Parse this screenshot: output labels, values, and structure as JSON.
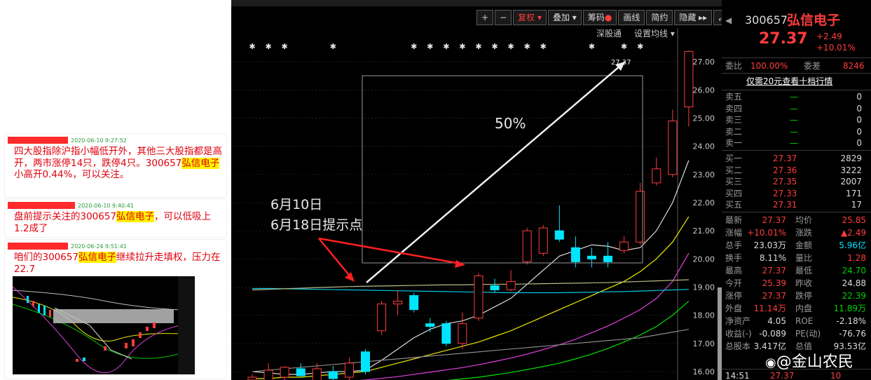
{
  "messages": [
    {
      "time": "2020-06-10 9:27:52",
      "parts": [
        "四大股指除沪指小幅低开外，其他三大股指都是高开，两市涨停14只，跌停4只。300657",
        "弘信电子",
        "小高开0.44%，可以关注。"
      ]
    },
    {
      "time": "2020-06-10 9:40:41",
      "parts": [
        "盘前提示关注的300657",
        "弘信电子",
        "，可以低吸上1.2成了"
      ]
    },
    {
      "time": "2020-06-24 9:51:41",
      "parts": [
        "咱们的300657",
        "弘信电子",
        "继续拉升走填权，压力在22.7"
      ]
    }
  ],
  "toolbar": {
    "fuquan": "复权 ▾",
    "diejia": "叠加 ▾",
    "chouma": "筹码",
    "huaxian": "画线",
    "jianyue": "简约",
    "yincang": "隐藏 ▸▸",
    "plus": "+",
    "minus": "−",
    "expand": "⤢"
  },
  "chart_header": {
    "shengutong": "深股通",
    "settings": "设置均线 ▾"
  },
  "annotations": {
    "pct": "50%",
    "d1": "6月10日",
    "d2": "6月18日提示点",
    "last": "27.37"
  },
  "chart_data": {
    "type": "candlestick",
    "y_axis_ticks": [
      "27.00",
      "26.00",
      "25.00",
      "24.00",
      "23.00",
      "22.00",
      "21.00",
      "20.00",
      "19.00",
      "18.00",
      "17.00",
      "16.00"
    ],
    "ylim": [
      15.7,
      28.2
    ],
    "candles": [
      {
        "o": 15.7,
        "c": 15.8,
        "h": 15.9,
        "l": 15.6
      },
      {
        "o": 15.65,
        "c": 16.05,
        "h": 16.3,
        "l": 15.5
      },
      {
        "o": 15.8,
        "c": 16.15,
        "h": 16.2,
        "l": 15.6
      },
      {
        "o": 16.1,
        "c": 15.85,
        "h": 16.3,
        "l": 15.8
      },
      {
        "o": 15.6,
        "c": 16.1,
        "h": 16.3,
        "l": 15.5
      },
      {
        "o": 16.0,
        "c": 15.75,
        "h": 16.2,
        "l": 15.6
      },
      {
        "o": 15.8,
        "c": 16.3,
        "h": 16.5,
        "l": 15.7
      },
      {
        "o": 16.7,
        "c": 16.0,
        "h": 16.8,
        "l": 15.9
      },
      {
        "o": 17.45,
        "c": 18.4,
        "h": 18.5,
        "l": 17.3
      },
      {
        "o": 18.4,
        "c": 18.5,
        "h": 18.9,
        "l": 18.0
      },
      {
        "o": 18.7,
        "c": 18.2,
        "h": 18.8,
        "l": 18.1
      },
      {
        "o": 17.7,
        "c": 17.6,
        "h": 17.9,
        "l": 17.4
      },
      {
        "o": 17.7,
        "c": 17.0,
        "h": 17.8,
        "l": 16.9
      },
      {
        "o": 17.0,
        "c": 17.7,
        "h": 18.1,
        "l": 16.8
      },
      {
        "o": 17.9,
        "c": 19.4,
        "h": 19.5,
        "l": 17.8
      },
      {
        "o": 19.05,
        "c": 18.9,
        "h": 19.3,
        "l": 18.8
      },
      {
        "o": 18.9,
        "c": 19.2,
        "h": 19.6,
        "l": 18.85
      },
      {
        "o": 19.9,
        "c": 21.0,
        "h": 21.1,
        "l": 19.8
      },
      {
        "o": 20.2,
        "c": 21.1,
        "h": 21.2,
        "l": 20.1
      },
      {
        "o": 21.0,
        "c": 20.7,
        "h": 21.9,
        "l": 20.6
      },
      {
        "o": 20.4,
        "c": 19.9,
        "h": 20.8,
        "l": 19.7
      },
      {
        "o": 20.1,
        "c": 20.0,
        "h": 20.4,
        "l": 19.7
      },
      {
        "o": 20.1,
        "c": 19.9,
        "h": 20.6,
        "l": 19.7
      },
      {
        "o": 20.3,
        "c": 20.6,
        "h": 20.8,
        "l": 20.2
      },
      {
        "o": 20.6,
        "c": 22.4,
        "h": 22.7,
        "l": 20.5
      },
      {
        "o": 22.7,
        "c": 23.2,
        "h": 23.6,
        "l": 22.6
      },
      {
        "o": 23.0,
        "c": 24.9,
        "h": 25.3,
        "l": 22.9
      },
      {
        "o": 25.4,
        "c": 27.37,
        "h": 27.4,
        "l": 24.7
      }
    ],
    "ma_series": [
      {
        "color": "#dcdcdc",
        "values": [
          16.0,
          15.95,
          15.9,
          15.9,
          15.95,
          16.0,
          16.0,
          16.05,
          16.4,
          16.8,
          17.2,
          17.5,
          17.7,
          17.8,
          18.0,
          18.3,
          18.6,
          19.1,
          19.6,
          20.1,
          20.3,
          20.5,
          20.45,
          20.3,
          20.4,
          21.0,
          22.0,
          23.5
        ]
      },
      {
        "color": "#e8e800",
        "values": [
          15.75,
          15.75,
          15.8,
          15.8,
          15.85,
          15.9,
          15.95,
          16.0,
          16.15,
          16.3,
          16.45,
          16.6,
          16.75,
          16.9,
          17.05,
          17.25,
          17.45,
          17.7,
          17.95,
          18.2,
          18.45,
          18.7,
          18.95,
          19.2,
          19.55,
          20.0,
          20.6,
          21.5
        ]
      },
      {
        "color": "#e040e0",
        "values": [
          15.5,
          15.5,
          15.52,
          15.55,
          15.58,
          15.62,
          15.66,
          15.7,
          15.76,
          15.82,
          15.9,
          15.98,
          16.06,
          16.14,
          16.24,
          16.36,
          16.48,
          16.62,
          16.78,
          16.95,
          17.15,
          17.38,
          17.62,
          17.9,
          18.2,
          18.6,
          19.2,
          20.2
        ]
      },
      {
        "color": "#00e000",
        "values": [
          15.3,
          15.32,
          15.34,
          15.36,
          15.38,
          15.4,
          15.43,
          15.46,
          15.5,
          15.54,
          15.58,
          15.63,
          15.68,
          15.74,
          15.8,
          15.88,
          15.97,
          16.07,
          16.18,
          16.3,
          16.45,
          16.62,
          16.82,
          17.05,
          17.3,
          17.6,
          18.0,
          18.5
        ]
      },
      {
        "color": "#00c8e6",
        "values": [
          18.95,
          18.95,
          18.94,
          18.93,
          18.92,
          18.91,
          18.9,
          18.89,
          18.88,
          18.87,
          18.86,
          18.85,
          18.84,
          18.83,
          18.82,
          18.81,
          18.8,
          18.8,
          18.8,
          18.8,
          18.81,
          18.82,
          18.83,
          18.84,
          18.86,
          18.88,
          18.9,
          18.92
        ]
      },
      {
        "color": "#bbbb88",
        "values": [
          18.9,
          18.92,
          18.94,
          18.96,
          18.98,
          19.0,
          19.02,
          19.03,
          19.04,
          19.05,
          19.06,
          19.07,
          19.08,
          19.08,
          19.09,
          19.1,
          19.1,
          19.11,
          19.12,
          19.13,
          19.14,
          19.15,
          19.16,
          19.18,
          19.2,
          19.22,
          19.24,
          19.26
        ]
      },
      {
        "color": "#8a8a8a",
        "values": [
          16.0,
          16.05,
          16.1,
          16.15,
          16.2,
          16.25,
          16.3,
          16.35,
          16.4,
          16.45,
          16.5,
          16.55,
          16.6,
          16.65,
          16.7,
          16.75,
          16.8,
          16.85,
          16.9,
          16.95,
          17.0,
          17.05,
          17.1,
          17.15,
          17.2,
          17.3,
          17.4,
          17.5
        ]
      }
    ],
    "star_markers": [
      0,
      1,
      2,
      5,
      10,
      11,
      12,
      13,
      14,
      15,
      16,
      17,
      18,
      21,
      23,
      24
    ]
  },
  "stock": {
    "code": "300657",
    "name": "弘信电子",
    "price": "27.37",
    "change": "+2.49",
    "pct": "+10.01%",
    "weibi_label": "委比",
    "weibi": "100.00%",
    "weicha_label": "委差",
    "weicha": "8246",
    "promo": "仅需20元查看十档行情",
    "sells": [
      {
        "label": "卖五",
        "price": "—",
        "vol": "0"
      },
      {
        "label": "卖四",
        "price": "—",
        "vol": "0"
      },
      {
        "label": "卖三",
        "price": "—",
        "vol": "0"
      },
      {
        "label": "卖二",
        "price": "—",
        "vol": "0"
      },
      {
        "label": "卖一",
        "price": "—",
        "vol": "0"
      }
    ],
    "buys": [
      {
        "label": "买一",
        "price": "27.37",
        "vol": "2829"
      },
      {
        "label": "买二",
        "price": "27.36",
        "vol": "3222"
      },
      {
        "label": "买三",
        "price": "27.35",
        "vol": "2007"
      },
      {
        "label": "买四",
        "price": "27.33",
        "vol": "171"
      },
      {
        "label": "买五",
        "price": "27.31",
        "vol": "17"
      }
    ],
    "stats": [
      {
        "l1": "最新",
        "v1": "27.37",
        "c1": "r",
        "l2": "均价",
        "v2": "25.85",
        "c2": "r"
      },
      {
        "l1": "涨幅",
        "v1": "+10.01%",
        "c1": "r",
        "l2": "涨跌",
        "v2": "▲2.49",
        "c2": "r"
      },
      {
        "l1": "总手",
        "v1": "23.03万",
        "c1": "w",
        "l2": "金额",
        "v2": "5.96亿",
        "c2": "cy"
      },
      {
        "l1": "换手",
        "v1": "8.11%",
        "c1": "w",
        "l2": "量比",
        "v2": "1.28",
        "c2": "r"
      },
      {
        "l1": "最高",
        "v1": "27.37",
        "c1": "r",
        "l2": "最低",
        "v2": "24.70",
        "c2": "gr"
      },
      {
        "l1": "今开",
        "v1": "25.39",
        "c1": "r",
        "l2": "昨收",
        "v2": "24.88",
        "c2": "w"
      },
      {
        "l1": "涨停",
        "v1": "27.37",
        "c1": "r",
        "l2": "跌停",
        "v2": "22.39",
        "c2": "gr"
      },
      {
        "l1": "外盘",
        "v1": "11.14万",
        "c1": "r",
        "l2": "内盘",
        "v2": "11.89万",
        "c2": "gr"
      },
      {
        "l1": "净资产",
        "v1": "4.05",
        "c1": "w",
        "l2": "ROE",
        "v2": "-2.18%",
        "c2": "w"
      },
      {
        "l1": "收益(-)",
        "v1": "-0.089",
        "c1": "w",
        "l2": "PE(动)",
        "v2": "-76.76",
        "c2": "w"
      },
      {
        "l1": "总股本",
        "v1": "3.417亿",
        "c1": "w",
        "l2": "总值",
        "v2": "93.53亿",
        "c2": "w"
      }
    ],
    "bottom": {
      "time": "14:51",
      "price": "27.37",
      "vol": "10"
    }
  },
  "watermark": "@金山农民"
}
